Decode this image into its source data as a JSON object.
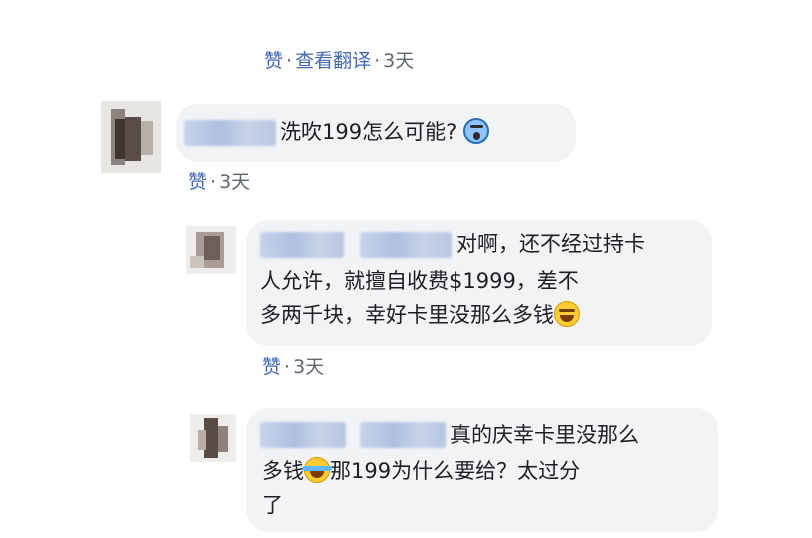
{
  "top_actions": {
    "like": "赞",
    "translate": "查看翻译",
    "separator": "·",
    "time": "3天"
  },
  "comments": [
    {
      "text_lines": [
        "洗吹199怎么可能?"
      ],
      "emoji": "face-screaming-in-fear",
      "like": "赞",
      "separator": "·",
      "time": "3天"
    },
    {
      "text_lines": [
        "对啊，还不经过持卡",
        "人允许，就擅自收费$1999，差不",
        "多两千块，幸好卡里没那么多钱"
      ],
      "emoji": "grinning-face-with-sweat",
      "like": "赞",
      "separator": "·",
      "time": "3天"
    },
    {
      "text_lines": [
        "真的庆幸卡里没那么",
        "多钱",
        "那199为什么要给？太过分",
        "了"
      ],
      "emoji": "face-with-tears-of-joy"
    }
  ]
}
